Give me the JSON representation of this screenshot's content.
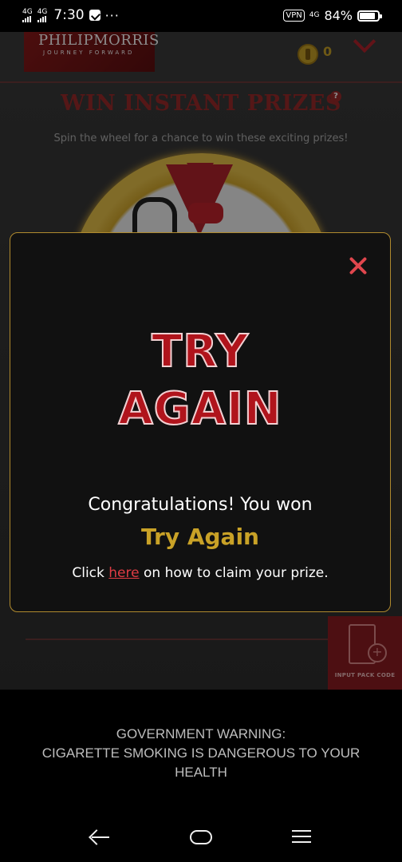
{
  "status_bar": {
    "signal1": "4G",
    "signal2": "4G",
    "time": "7:30",
    "dots": "···",
    "vpn": "VPN",
    "network": "4G",
    "battery": "84%"
  },
  "header": {
    "brand": "PHILIPMORRIS",
    "tagline": "JOURNEY FORWARD",
    "coins": "0"
  },
  "page": {
    "title": "WIN INSTANT PRIZES",
    "help": "?",
    "subtitle": "Spin the wheel for a chance to win these exciting prizes!",
    "pack_code_label": "INPUT PACK CODE"
  },
  "modal": {
    "line1": "TRY",
    "line2": "AGAIN",
    "congrats": "Congratulations! You won",
    "result": "Try Again",
    "claim_prefix": "Click ",
    "claim_link": "here",
    "claim_suffix": " on how to claim your prize."
  },
  "warning": {
    "line1": "GOVERNMENT WARNING:",
    "line2": "CIGARETTE SMOKING IS DANGEROUS TO YOUR",
    "line3": "HEALTH"
  },
  "colors": {
    "brand_red": "#b3242d",
    "gold": "#c9a227"
  }
}
